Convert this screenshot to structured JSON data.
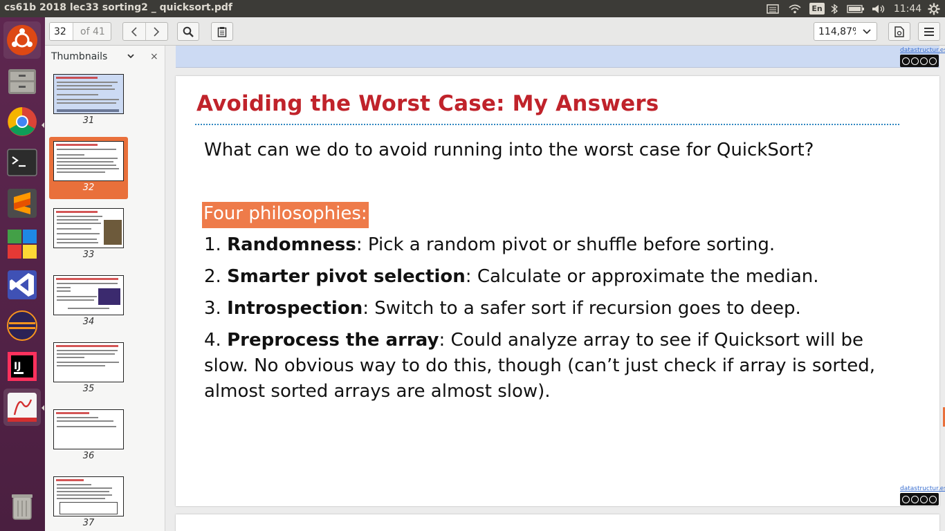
{
  "window": {
    "title": "cs61b 2018 lec33 sorting2 _ quicksort.pdf",
    "tray": {
      "language": "En",
      "clock": "11:44"
    }
  },
  "launcher": {
    "items": [
      "ubuntu-dash",
      "files",
      "chrome",
      "terminal",
      "sublime-text",
      "libreoffice",
      "vscode",
      "eclipse",
      "intellij",
      "pdf-viewer",
      "trash"
    ]
  },
  "toolbar": {
    "page_current": "32",
    "page_of": "of 41",
    "zoom": "114,87%"
  },
  "sidebar": {
    "title": "Thumbnails",
    "close_glyph": "×",
    "thumbnails": [
      {
        "label": "31"
      },
      {
        "label": "32"
      },
      {
        "label": "33"
      },
      {
        "label": "34"
      },
      {
        "label": "35"
      },
      {
        "label": "36"
      },
      {
        "label": "37"
      }
    ]
  },
  "slide": {
    "title": "Avoiding the Worst Case: My Answers",
    "question": "What can we do to avoid running into the worst case for QuickSort?",
    "philosophies_label": "Four philosophies:",
    "items": [
      {
        "num": "1.",
        "bold": "Randomness",
        "rest": ": Pick a random pivot or shuffle before sorting."
      },
      {
        "num": "2.",
        "bold": "Smarter pivot selection",
        "rest": ": Calculate or approximate the median."
      },
      {
        "num": "3.",
        "bold": "Introspection",
        "rest": ": Switch to a safer sort if recursion goes to deep."
      },
      {
        "num": "4.",
        "bold": "Preprocess the array",
        "rest": ": Could analyze array to see if Quicksort will be slow. No obvious way to do this, though (can’t just check if array is sorted, almost sorted arrays are almost slow)."
      }
    ],
    "credit": "datastructur.es"
  },
  "colors": {
    "title_red": "#c0232b",
    "badge_orange": "#ee7b4a",
    "selection_orange": "#e9703b",
    "rule_blue": "#2e86c1"
  }
}
